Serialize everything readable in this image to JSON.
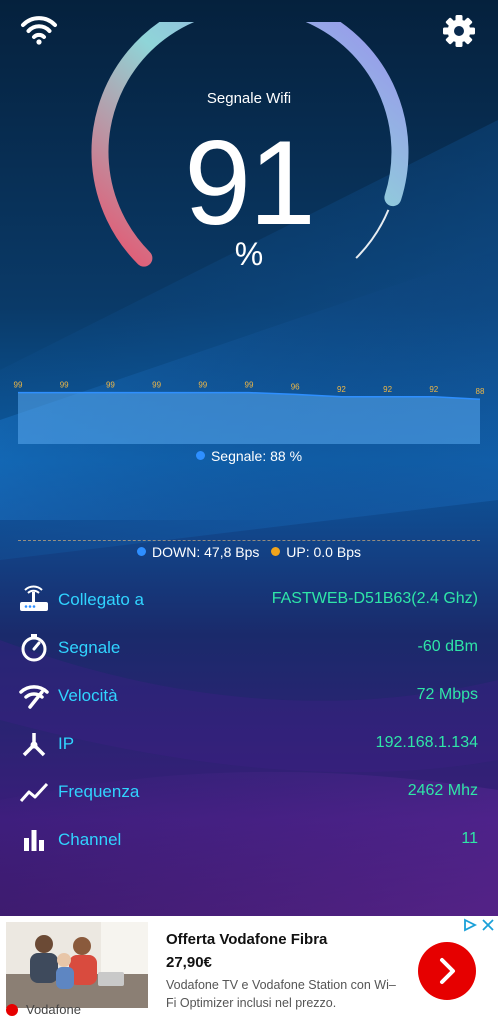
{
  "colors": {
    "label": "#30d4ff",
    "value": "#2fe6a8",
    "gauge_start": "#e8536e",
    "gauge_mid": "#8fd5d8",
    "gauge_end": "#9a8cf0",
    "download_dot": "#2e8fff",
    "upload_dot": "#f0a41c",
    "ad_accent": "#e60000"
  },
  "top_bar": {
    "wifi_icon": "wifi-icon",
    "settings_icon": "gear-icon"
  },
  "gauge": {
    "title": "Segnale Wifi",
    "value": "91",
    "unit": "%",
    "level": 0.91
  },
  "chart_data": {
    "type": "area",
    "x": [
      1,
      2,
      3,
      4,
      5,
      6,
      7,
      8,
      9,
      10,
      11
    ],
    "values": [
      99,
      99,
      99,
      99,
      99,
      99,
      96,
      92,
      92,
      92,
      88
    ],
    "data_labels": [
      "99",
      "99",
      "99",
      "99",
      "99",
      "99",
      "96",
      "92",
      "92",
      "92",
      "88"
    ],
    "ylim": [
      0,
      100
    ],
    "grid": false,
    "legend": "bottom",
    "series": [
      {
        "name": "Segnale: 88 %"
      }
    ]
  },
  "legend": {
    "signal_label": "Segnale: 88 %"
  },
  "traffic": {
    "down_label": "DOWN: 47,8 Bps",
    "up_label": "UP: 0.0 Bps"
  },
  "info": [
    {
      "icon": "router-icon",
      "label": "Collegato a",
      "value": "FASTWEB-D51B63(2.4 Ghz)"
    },
    {
      "icon": "gauge-icon",
      "label": "Segnale",
      "value": "-60 dBm"
    },
    {
      "icon": "wifi-speed-icon",
      "label": "Velocità",
      "value": "72 Mbps"
    },
    {
      "icon": "network-node-icon",
      "label": "IP",
      "value": "192.168.1.134"
    },
    {
      "icon": "trend-line-icon",
      "label": "Frequenza",
      "value": "2462 Mhz"
    },
    {
      "icon": "bar-chart-icon",
      "label": "Channel",
      "value": "11"
    }
  ],
  "ad": {
    "title": "Offerta Vodafone Fibra",
    "price": "27,90€",
    "description": "Vodafone TV e Vodafone Station con Wi–Fi Optimizer inclusi nel prezzo.",
    "brand": "Vodafone",
    "cta_icon": "chevron-right-icon",
    "choices_icon": "ad-choices-icon",
    "close_icon": "close-icon"
  }
}
